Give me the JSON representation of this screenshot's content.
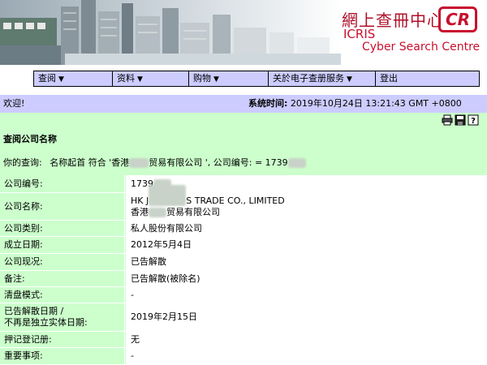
{
  "banner": {
    "title_cn": "網上查冊中心",
    "logo_cr": "CR",
    "icris": "ICRIS",
    "subtitle": "Cyber Search Centre"
  },
  "menu": {
    "items": [
      {
        "label": "查阅",
        "caret": "▼"
      },
      {
        "label": "资料",
        "caret": "▼"
      },
      {
        "label": "购物",
        "caret": "▼"
      },
      {
        "label": "关於电子查册服务",
        "caret": "▼"
      },
      {
        "label": "登出",
        "caret": ""
      }
    ]
  },
  "welcome": {
    "greeting": "欢迎!",
    "time_label": "系统时间:",
    "time_value": "2019年10月24日 13:21:43 GMT +0800"
  },
  "section_title": "查阅公司名称",
  "query": {
    "prefix": "你的查询:",
    "part1": "名称起首 符合 '香港",
    "part2": "贸易有限公司 ', 公司编号: = 1739"
  },
  "details": {
    "company_no": {
      "label": "公司编号:",
      "value": "1739"
    },
    "company_name": {
      "label": "公司名称:",
      "value_en_prefix": "HK",
      "value_en_mid": "J",
      "value_en_suffix": "S TRADE CO., LIMITED",
      "value_cn_prefix": "香港",
      "value_cn_suffix": "贸易有限公司"
    },
    "company_type": {
      "label": "公司类别:",
      "value": "私人股份有限公司"
    },
    "incorporation_date": {
      "label": "成立日期:",
      "value": "2012年5月4日"
    },
    "status": {
      "label": "公司现况:",
      "value": "已告解散"
    },
    "remarks": {
      "label": "备注:",
      "value": "已告解散(被除名)"
    },
    "winding_up": {
      "label": "清盘模式:",
      "value": "-"
    },
    "dissolution_date": {
      "label_line1": "已告解散日期 /",
      "label_line2": "不再是独立实体日期:",
      "value": "2019年2月15日"
    },
    "charges": {
      "label": "押记登记册:",
      "value": "无"
    },
    "important_notes": {
      "label": "重要事项:",
      "value": "-"
    }
  },
  "icons": [
    "printer-icon",
    "save-icon",
    "help-icon"
  ],
  "colors": {
    "menu_bg": "#ccccff",
    "main_bg": "#ccffcc",
    "brand_red": "#c8102e"
  }
}
